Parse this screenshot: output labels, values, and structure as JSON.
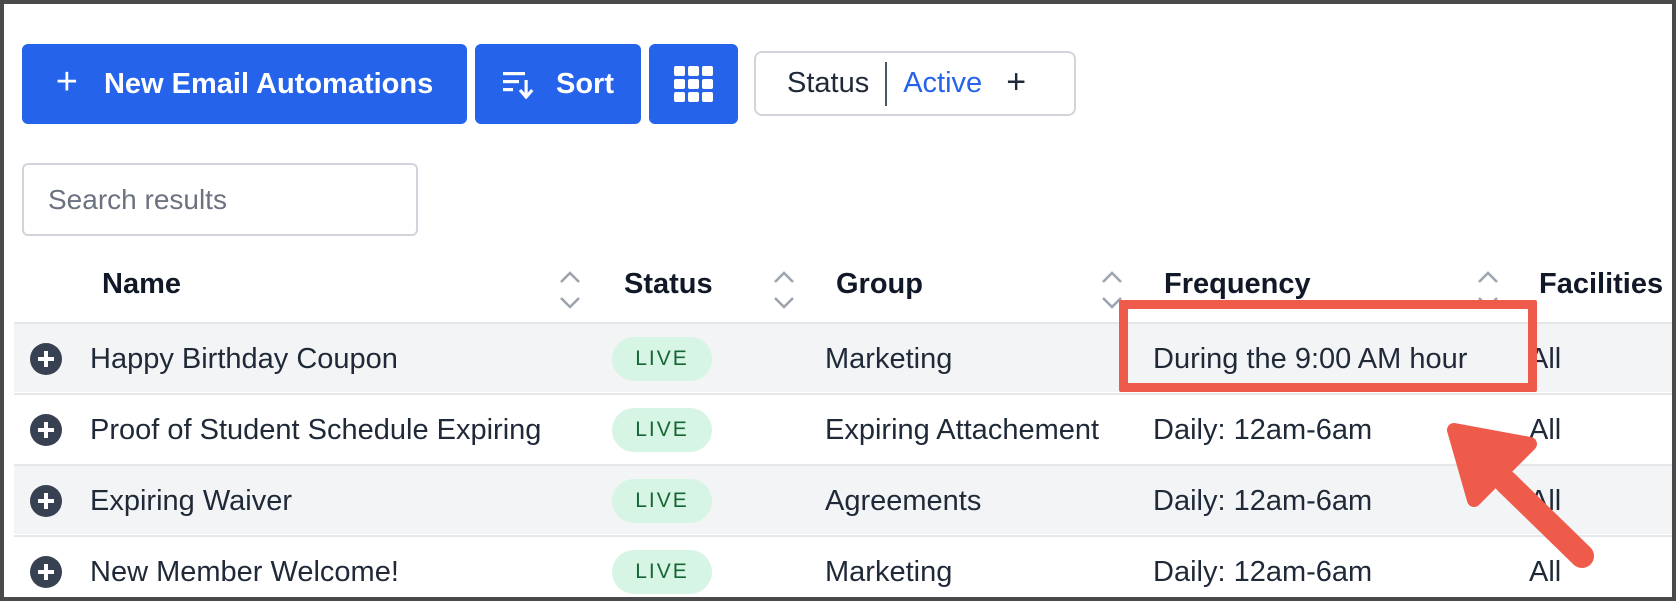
{
  "toolbar": {
    "new_button_label": "New Email Automations",
    "sort_button_label": "Sort",
    "grid_icon": "grid-icon",
    "filter": {
      "label": "Status",
      "value": "Active"
    }
  },
  "search": {
    "placeholder": "Search results",
    "value": ""
  },
  "table": {
    "columns": [
      "Name",
      "Status",
      "Group",
      "Frequency",
      "Facilities"
    ],
    "rows": [
      {
        "name": "Happy Birthday Coupon",
        "status": "LIVE",
        "group": "Marketing",
        "frequency": "During the 9:00 AM hour",
        "facilities": "All"
      },
      {
        "name": "Proof of Student Schedule Expiring",
        "status": "LIVE",
        "group": "Expiring Attachement",
        "frequency": "Daily: 12am-6am",
        "facilities": "All"
      },
      {
        "name": "Expiring Waiver",
        "status": "LIVE",
        "group": "Agreements",
        "frequency": "Daily: 12am-6am",
        "facilities": "All"
      },
      {
        "name": "New Member Welcome!",
        "status": "LIVE",
        "group": "Marketing",
        "frequency": "Daily: 12am-6am",
        "facilities": "All"
      }
    ]
  },
  "colors": {
    "primary": "#2563eb",
    "live_badge_bg": "#d7f5e5",
    "live_badge_text": "#166534",
    "annotation": "#ef5b4b",
    "row_shade": "#f3f4f6"
  }
}
